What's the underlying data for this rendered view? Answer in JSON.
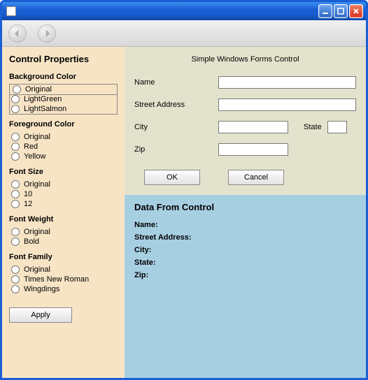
{
  "window": {
    "title": ""
  },
  "sidebar": {
    "heading": "Control Properties",
    "groups": {
      "background": {
        "title": "Background Color",
        "options": [
          "Original",
          "LightGreen",
          "LightSalmon"
        ],
        "selected": null
      },
      "foreground": {
        "title": "Foreground Color",
        "options": [
          "Original",
          "Red",
          "Yellow"
        ],
        "selected": null
      },
      "fontsize": {
        "title": "Font Size",
        "options": [
          "Original",
          "10",
          "12"
        ],
        "selected": null
      },
      "fontweight": {
        "title": "Font Weight",
        "options": [
          "Original",
          "Bold"
        ],
        "selected": null
      },
      "fontfamily": {
        "title": "Font Family",
        "options": [
          "Original",
          "Times New Roman",
          "Wingdings"
        ],
        "selected": null
      }
    },
    "apply_label": "Apply"
  },
  "form": {
    "title": "Simple Windows Forms Control",
    "fields": {
      "name": {
        "label": "Name",
        "value": ""
      },
      "street": {
        "label": "Street Address",
        "value": ""
      },
      "city": {
        "label": "City",
        "value": ""
      },
      "state": {
        "label": "State",
        "value": ""
      },
      "zip": {
        "label": "Zip",
        "value": ""
      }
    },
    "ok_label": "OK",
    "cancel_label": "Cancel"
  },
  "data_output": {
    "heading": "Data From Control",
    "lines": {
      "name": "Name:",
      "street": "Street Address:",
      "city": "City:",
      "state": "State:",
      "zip": "Zip:"
    }
  }
}
